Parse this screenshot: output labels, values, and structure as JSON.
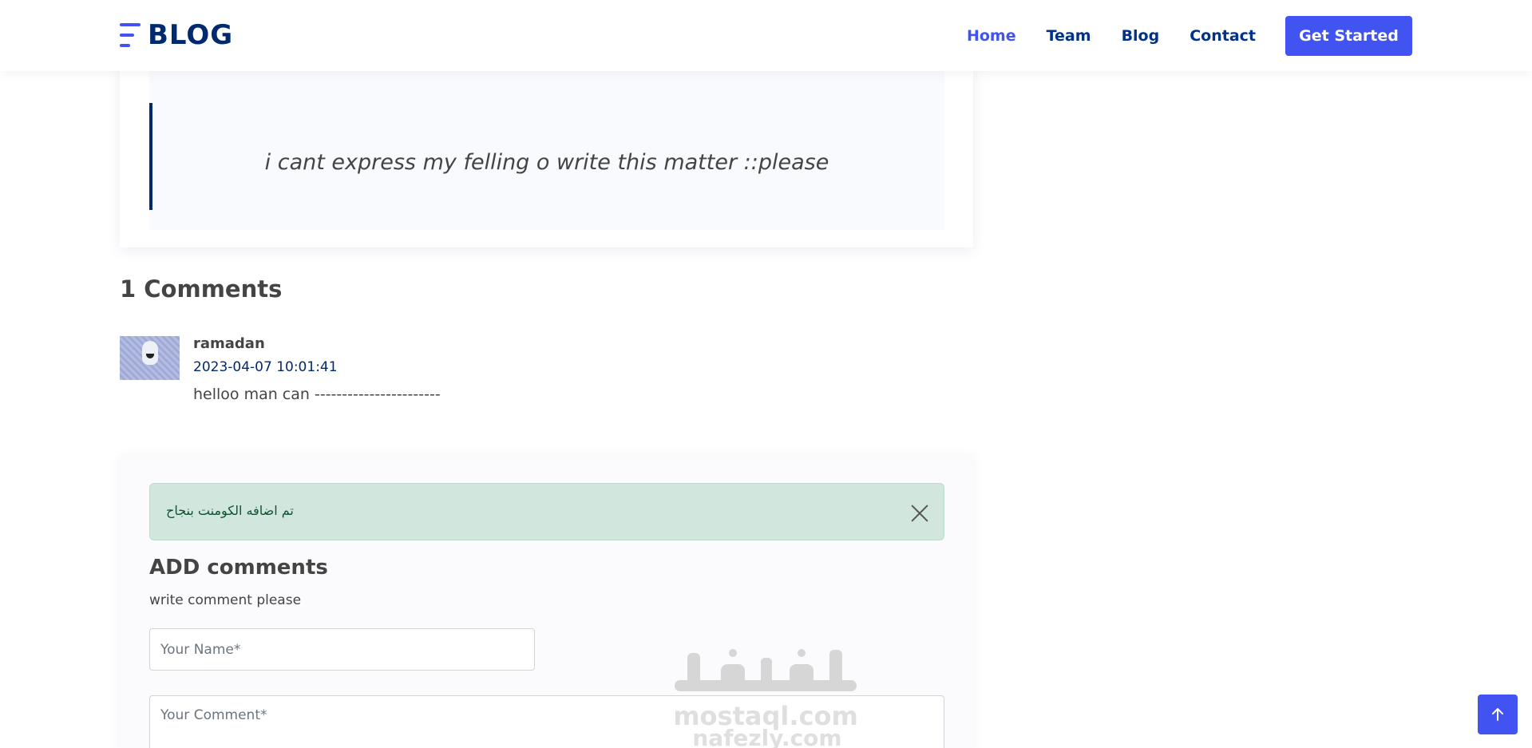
{
  "header": {
    "logo_text": "BLOG",
    "nav": [
      {
        "label": "Home",
        "active": true
      },
      {
        "label": "Team",
        "active": false
      },
      {
        "label": "Blog",
        "active": false
      },
      {
        "label": "Contact",
        "active": false
      }
    ],
    "cta_label": "Get Started"
  },
  "post": {
    "quote": "i cant express my felling o write this matter ::please"
  },
  "comments": {
    "title": "1 Comments",
    "items": [
      {
        "author": "ramadan",
        "date": "2023-04-07 10:01:41",
        "text": "helloo man can -----------------------"
      }
    ]
  },
  "form": {
    "alert_text": "تم اضافه الكومنت بنجاح",
    "title": "ADD comments",
    "subtitle": "write comment please",
    "name_placeholder": "Your Name*",
    "comment_placeholder": "Your Comment*"
  },
  "watermark": {
    "line1": "mostaql.com",
    "line2": "nafezly.com"
  },
  "colors": {
    "primary": "#4154f1",
    "navy": "#012970",
    "alert_bg": "#d1e7dd"
  },
  "icons": {
    "back_to_top": "arrow-up-icon",
    "alert_close": "close-icon",
    "logo": "menu-lines-icon"
  }
}
